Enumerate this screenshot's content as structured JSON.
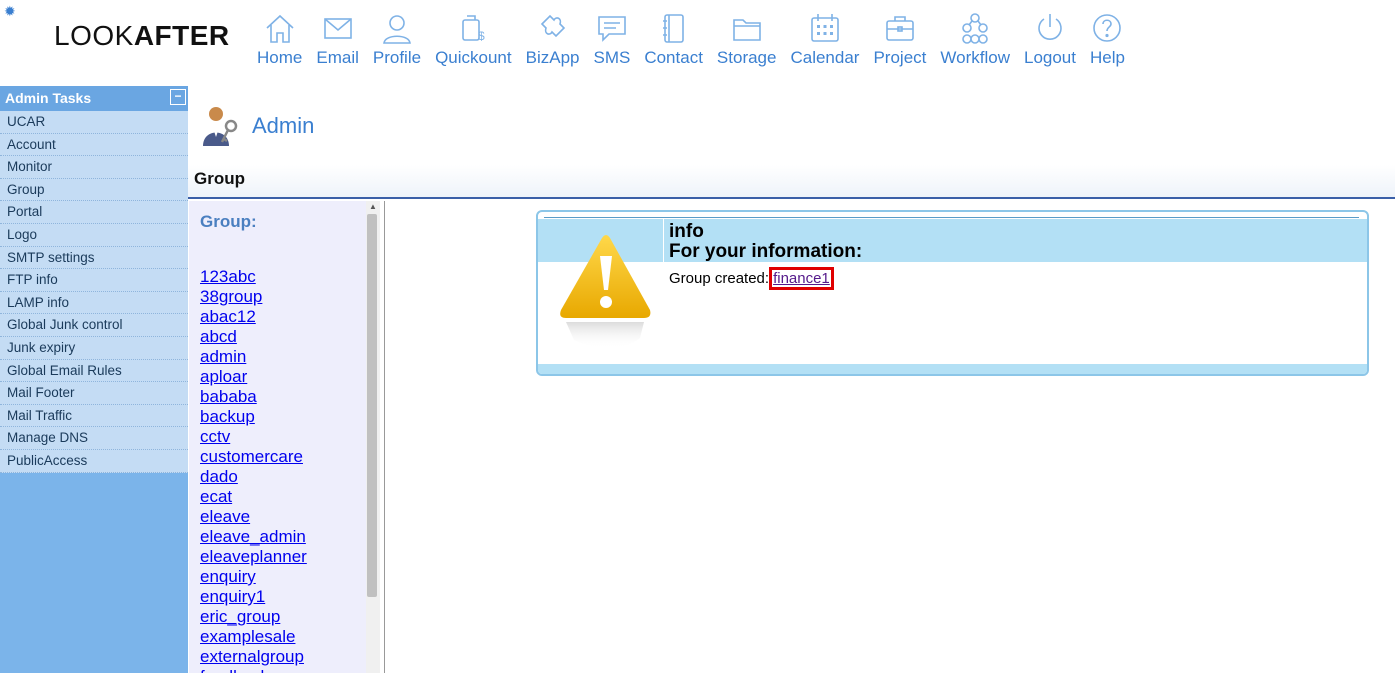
{
  "logo": {
    "light": "LOOK",
    "bold": "AFTER"
  },
  "nav": {
    "home": "Home",
    "email": "Email",
    "profile": "Profile",
    "quickount": "Quickount",
    "bizapp": "BizApp",
    "sms": "SMS",
    "contact": "Contact",
    "storage": "Storage",
    "calendar": "Calendar",
    "project": "Project",
    "workflow": "Workflow",
    "logout": "Logout",
    "help": "Help"
  },
  "sidebar": {
    "title": "Admin Tasks",
    "items": [
      "UCAR",
      "Account",
      "Monitor",
      "Group",
      "Portal",
      "Logo",
      "SMTP settings",
      "FTP info",
      "LAMP info",
      "Global Junk control",
      "Junk expiry",
      "Global Email Rules",
      "Mail Footer",
      "Mail Traffic",
      "Manage DNS",
      "PublicAccess"
    ]
  },
  "page": {
    "title": "Admin",
    "section": "Group"
  },
  "grouplist": {
    "heading": "Group:",
    "groups": [
      "123abc",
      "38group",
      "abac12",
      "abcd",
      "admin",
      "aploar",
      "bababa",
      "backup",
      "cctv",
      "customercare",
      "dado",
      "ecat",
      "eleave",
      "eleave_admin",
      "eleaveplanner",
      "enquiry",
      "enquiry1",
      "eric_group",
      "examplesale",
      "externalgroup",
      "feedback"
    ]
  },
  "info": {
    "line1": "info",
    "line2": "For your information:",
    "message": "Group created:",
    "link": "finance1"
  },
  "colors": {
    "accent": "#3a7fd0",
    "sidebar": "#7bb4ea",
    "highlight": "#e00000"
  }
}
